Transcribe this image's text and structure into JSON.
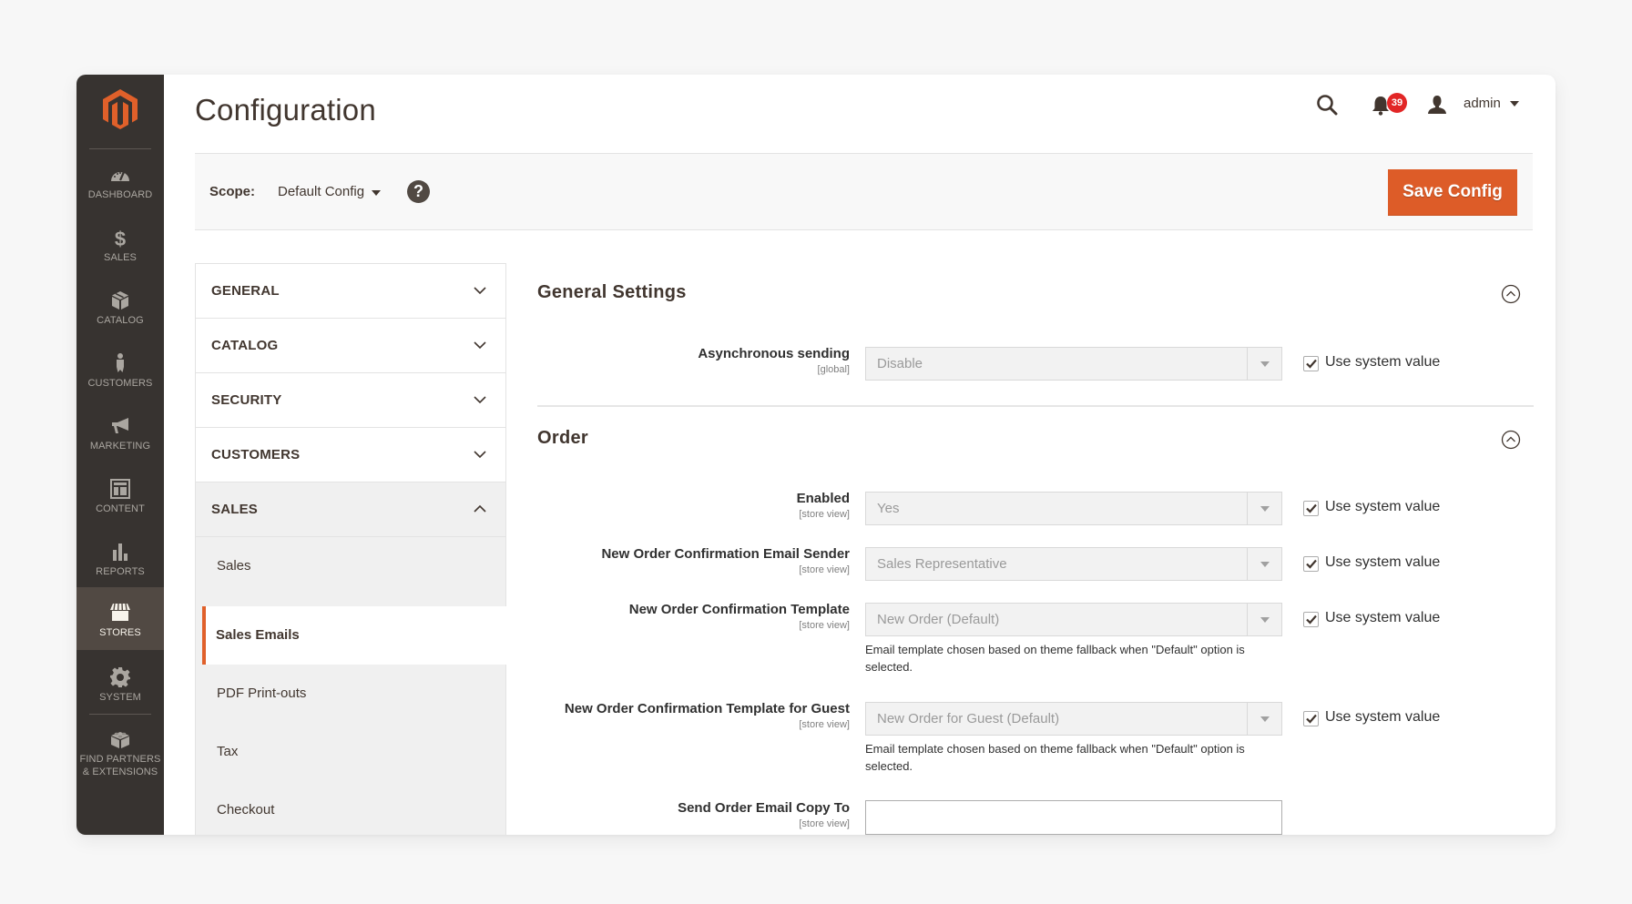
{
  "menu": {
    "items": [
      {
        "label": "DASHBOARD",
        "icon": "dashboard-icon"
      },
      {
        "label": "SALES",
        "icon": "dollar-icon"
      },
      {
        "label": "CATALOG",
        "icon": "box-icon"
      },
      {
        "label": "CUSTOMERS",
        "icon": "person-icon"
      },
      {
        "label": "MARKETING",
        "icon": "megaphone-icon"
      },
      {
        "label": "CONTENT",
        "icon": "layout-icon"
      },
      {
        "label": "REPORTS",
        "icon": "bar-chart-icon"
      },
      {
        "label": "STORES",
        "icon": "storefront-icon",
        "active": true
      },
      {
        "label": "SYSTEM",
        "icon": "gear-icon"
      },
      {
        "label": "FIND PARTNERS",
        "label2": "& EXTENSIONS",
        "icon": "lego-brick-icon"
      }
    ]
  },
  "header": {
    "title": "Configuration",
    "notifications_count": "39",
    "user_name": "admin"
  },
  "scope": {
    "label": "Scope:",
    "value": "Default Config",
    "help_glyph": "?",
    "save_label": "Save Config"
  },
  "colors": {
    "accent": "#dd5c28",
    "sidebar": "#373330",
    "sidebar_active": "#514943",
    "badge": "#e22626"
  },
  "tabs": [
    {
      "label": "GENERAL",
      "open": false
    },
    {
      "label": "CATALOG",
      "open": false
    },
    {
      "label": "SECURITY",
      "open": false
    },
    {
      "label": "CUSTOMERS",
      "open": false
    },
    {
      "label": "SALES",
      "open": true
    }
  ],
  "sales_subitems": [
    {
      "label": "Sales"
    },
    {
      "label": "Sales Emails",
      "active": true
    },
    {
      "label": "PDF Print-outs"
    },
    {
      "label": "Tax"
    },
    {
      "label": "Checkout"
    }
  ],
  "sections": {
    "general": {
      "title": "General Settings",
      "fields": [
        {
          "label": "Asynchronous sending",
          "scope": "[global]",
          "value": "Disable",
          "use_system_value": "Use system value",
          "checked": true
        }
      ]
    },
    "order": {
      "title": "Order",
      "fields": [
        {
          "label": "Enabled",
          "scope": "[store view]",
          "value": "Yes",
          "use_system_value": "Use system value",
          "checked": true
        },
        {
          "label": "New Order Confirmation Email Sender",
          "scope": "[store view]",
          "value": "Sales Representative",
          "use_system_value": "Use system value",
          "checked": true
        },
        {
          "label": "New Order Confirmation Template",
          "scope": "[store view]",
          "value": "New Order (Default)",
          "note": "Email template chosen based on theme fallback when \"Default\" option is selected.",
          "use_system_value": "Use system value",
          "checked": true
        },
        {
          "label": "New Order Confirmation Template for Guest",
          "scope": "[store view]",
          "value": "New Order for Guest (Default)",
          "note": "Email template chosen based on theme fallback when \"Default\" option is selected.",
          "use_system_value": "Use system value",
          "checked": true
        },
        {
          "label": "Send Order Email Copy To",
          "scope": "[store view]",
          "value": "",
          "placeholder": ""
        }
      ]
    }
  }
}
